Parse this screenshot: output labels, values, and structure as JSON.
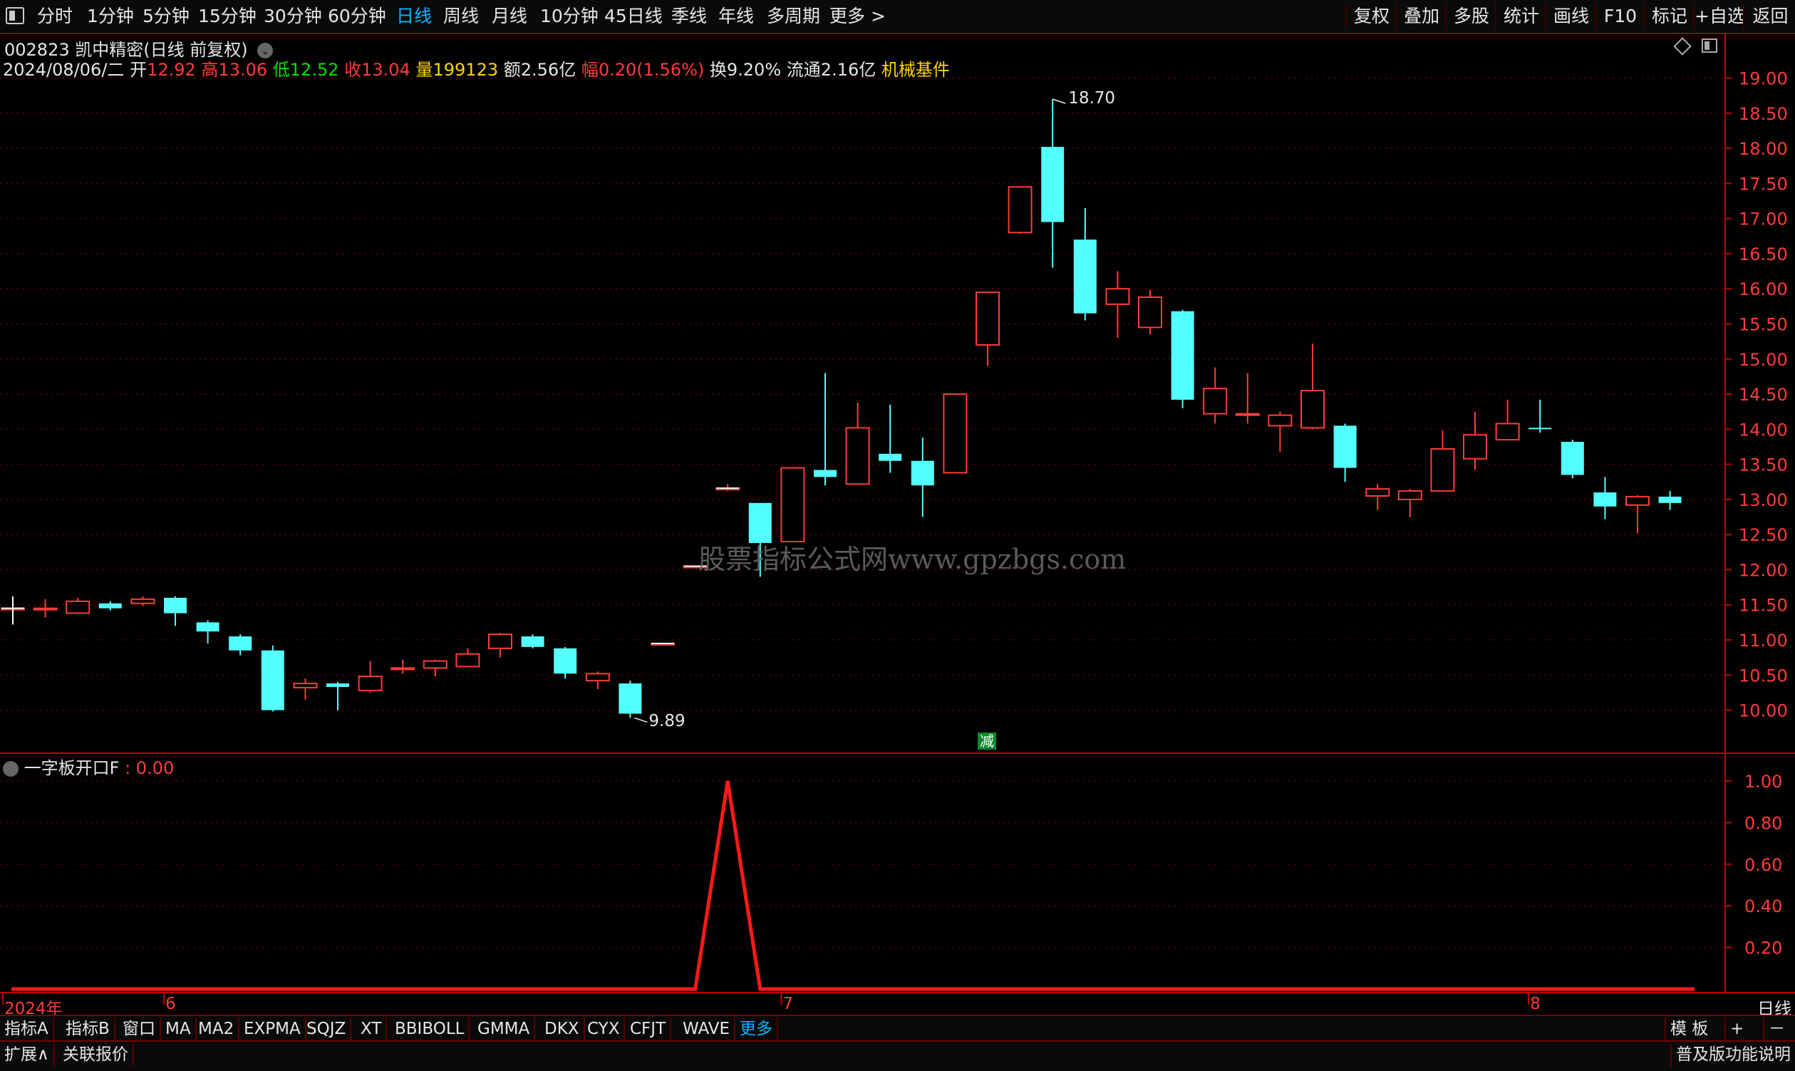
{
  "toolbar": {
    "menu_icon": "window-menu-icon",
    "periods": [
      "分时",
      "1分钟",
      "5分钟",
      "15分钟",
      "30分钟",
      "60分钟",
      "日线",
      "周线",
      "月线",
      "10分钟",
      "45日线",
      "季线",
      "年线",
      "多周期"
    ],
    "active_period": "日线",
    "more": "更多 >",
    "right_buttons": [
      "复权",
      "叠加",
      "多股",
      "统计",
      "画线",
      "F10",
      "标记",
      "+自选",
      "返回"
    ]
  },
  "stock": {
    "code_name": "002823 凯中精密(日线 前复权)",
    "date": "2024/08/06/二",
    "open_label": "开",
    "open": "12.92",
    "high_label": "高",
    "high": "13.06",
    "low_label": "低",
    "low": "12.52",
    "close_label": "收",
    "close": "13.04",
    "volume_label": "量",
    "volume": "199123",
    "amount_label": "额",
    "amount": "2.56亿",
    "change_label": "幅",
    "change": "0.20(1.56%)",
    "turnover_label": "换",
    "turnover": "9.20%",
    "float_label": "流通",
    "float": "2.16亿",
    "sector": "机械基件"
  },
  "colors": {
    "up": "#ff3b3b",
    "down": "#54ffff",
    "low_green": "#00e000",
    "volume": "#ffd400",
    "sector": "#ffd400",
    "axis": "#c00000",
    "indicator": "#ff1a1a",
    "active": "#00b7ff"
  },
  "price_axis": {
    "min": 9.6,
    "max": 19.3,
    "ticks": [
      "19.00",
      "18.50",
      "18.00",
      "17.50",
      "17.00",
      "16.50",
      "16.00",
      "15.50",
      "15.00",
      "14.50",
      "14.00",
      "13.50",
      "13.00",
      "12.50",
      "12.00",
      "11.50",
      "11.00",
      "10.50",
      "10.00"
    ]
  },
  "annotations": {
    "max_label": "18.70",
    "min_label": "9.89",
    "event_badge": "减"
  },
  "watermark": "股票指标公式网www.gpzbgs.com",
  "candles": [
    [
      11.45,
      11.45,
      11.62,
      11.22
    ],
    [
      11.45,
      11.45,
      11.58,
      11.32
    ],
    [
      11.38,
      11.55,
      11.6,
      11.38
    ],
    [
      11.52,
      11.45,
      11.55,
      11.42
    ],
    [
      11.52,
      11.58,
      11.62,
      11.48
    ],
    [
      11.6,
      11.38,
      11.62,
      11.2
    ],
    [
      11.25,
      11.12,
      11.28,
      10.95
    ],
    [
      11.05,
      10.85,
      11.08,
      10.78
    ],
    [
      10.85,
      10.0,
      10.92,
      9.98
    ],
    [
      10.32,
      10.38,
      10.45,
      10.15
    ],
    [
      10.38,
      10.33,
      10.4,
      10.0
    ],
    [
      10.28,
      10.48,
      10.7,
      10.25
    ],
    [
      10.6,
      10.6,
      10.72,
      10.52
    ],
    [
      10.6,
      10.7,
      10.72,
      10.48
    ],
    [
      10.62,
      10.8,
      10.88,
      10.62
    ],
    [
      10.88,
      11.08,
      11.1,
      10.75
    ],
    [
      11.05,
      10.9,
      11.08,
      10.88
    ],
    [
      10.88,
      10.52,
      10.9,
      10.45
    ],
    [
      10.42,
      10.52,
      10.55,
      10.3
    ],
    [
      10.38,
      9.95,
      10.42,
      9.89
    ],
    [
      10.95,
      10.95,
      10.95,
      10.95
    ],
    [
      12.05,
      12.05,
      12.05,
      12.05
    ],
    [
      13.16,
      13.16,
      13.22,
      13.12
    ],
    [
      12.95,
      12.38,
      12.95,
      11.9
    ],
    [
      12.4,
      13.45,
      13.45,
      12.4
    ],
    [
      13.42,
      13.32,
      14.8,
      13.2
    ],
    [
      13.22,
      14.02,
      14.38,
      13.22
    ],
    [
      13.65,
      13.55,
      14.35,
      13.38
    ],
    [
      13.55,
      13.2,
      13.88,
      12.75
    ],
    [
      13.38,
      14.5,
      14.5,
      13.38
    ],
    [
      15.2,
      15.95,
      15.95,
      14.9
    ],
    [
      16.8,
      17.45,
      17.45,
      16.78
    ],
    [
      18.02,
      16.95,
      18.7,
      16.3
    ],
    [
      16.7,
      15.65,
      17.15,
      15.55
    ],
    [
      15.78,
      16.0,
      16.25,
      15.3
    ],
    [
      15.45,
      15.88,
      15.98,
      15.35
    ],
    [
      15.68,
      14.42,
      15.7,
      14.3
    ],
    [
      14.22,
      14.58,
      14.88,
      14.08
    ],
    [
      14.2,
      14.22,
      14.8,
      14.08
    ],
    [
      14.05,
      14.2,
      14.25,
      13.68
    ],
    [
      14.02,
      14.55,
      15.22,
      14.0
    ],
    [
      14.05,
      13.45,
      14.08,
      13.25
    ],
    [
      13.05,
      13.15,
      13.22,
      12.85
    ],
    [
      13.0,
      13.12,
      13.15,
      12.75
    ],
    [
      13.12,
      13.72,
      13.98,
      13.12
    ],
    [
      13.58,
      13.92,
      14.25,
      13.42
    ],
    [
      13.85,
      14.08,
      14.42,
      13.85
    ],
    [
      14.02,
      14.0,
      14.42,
      13.95
    ],
    [
      13.82,
      13.35,
      13.85,
      13.3
    ],
    [
      13.1,
      12.9,
      13.32,
      12.72
    ],
    [
      12.92,
      13.04,
      13.06,
      12.52
    ],
    [
      13.04,
      12.95,
      13.12,
      12.85
    ]
  ],
  "indicator": {
    "name": "一字板开口F",
    "value_text": ": 0.00",
    "ticks": [
      "1.00",
      "0.80",
      "0.60",
      "0.40",
      "0.20"
    ],
    "min": 0,
    "max": 1.0,
    "values": [
      0,
      0,
      0,
      0,
      0,
      0,
      0,
      0,
      0,
      0,
      0,
      0,
      0,
      0,
      0,
      0,
      0,
      0,
      0,
      0,
      0,
      0,
      1,
      0,
      0,
      0,
      0,
      0,
      0,
      0,
      0,
      0,
      0,
      0,
      0,
      0,
      0,
      0,
      0,
      0,
      0,
      0,
      0,
      0,
      0,
      0,
      0,
      0,
      0,
      0,
      0,
      0
    ]
  },
  "date_axis": {
    "labels": [
      {
        "text": "2024年",
        "bar": 0
      },
      {
        "text": "6",
        "bar": 5
      },
      {
        "text": "7",
        "bar": 24
      },
      {
        "text": "8",
        "bar": 47
      }
    ],
    "period_label": "日线"
  },
  "indicator_tabs": [
    "指标A",
    "指标B",
    "窗口",
    "MA",
    "MA2",
    "EXPMA",
    "SQJZ",
    "XT",
    "BBIBOLL",
    "GMMA",
    "DKX",
    "CYX",
    "CFJT",
    "WAVE",
    "更多"
  ],
  "active_tab": "更多",
  "bottom_right": [
    "模 板",
    "+",
    "－"
  ],
  "footer": {
    "expand": "扩展∧",
    "quote": "关联报价",
    "right": "普及版功能说明"
  }
}
